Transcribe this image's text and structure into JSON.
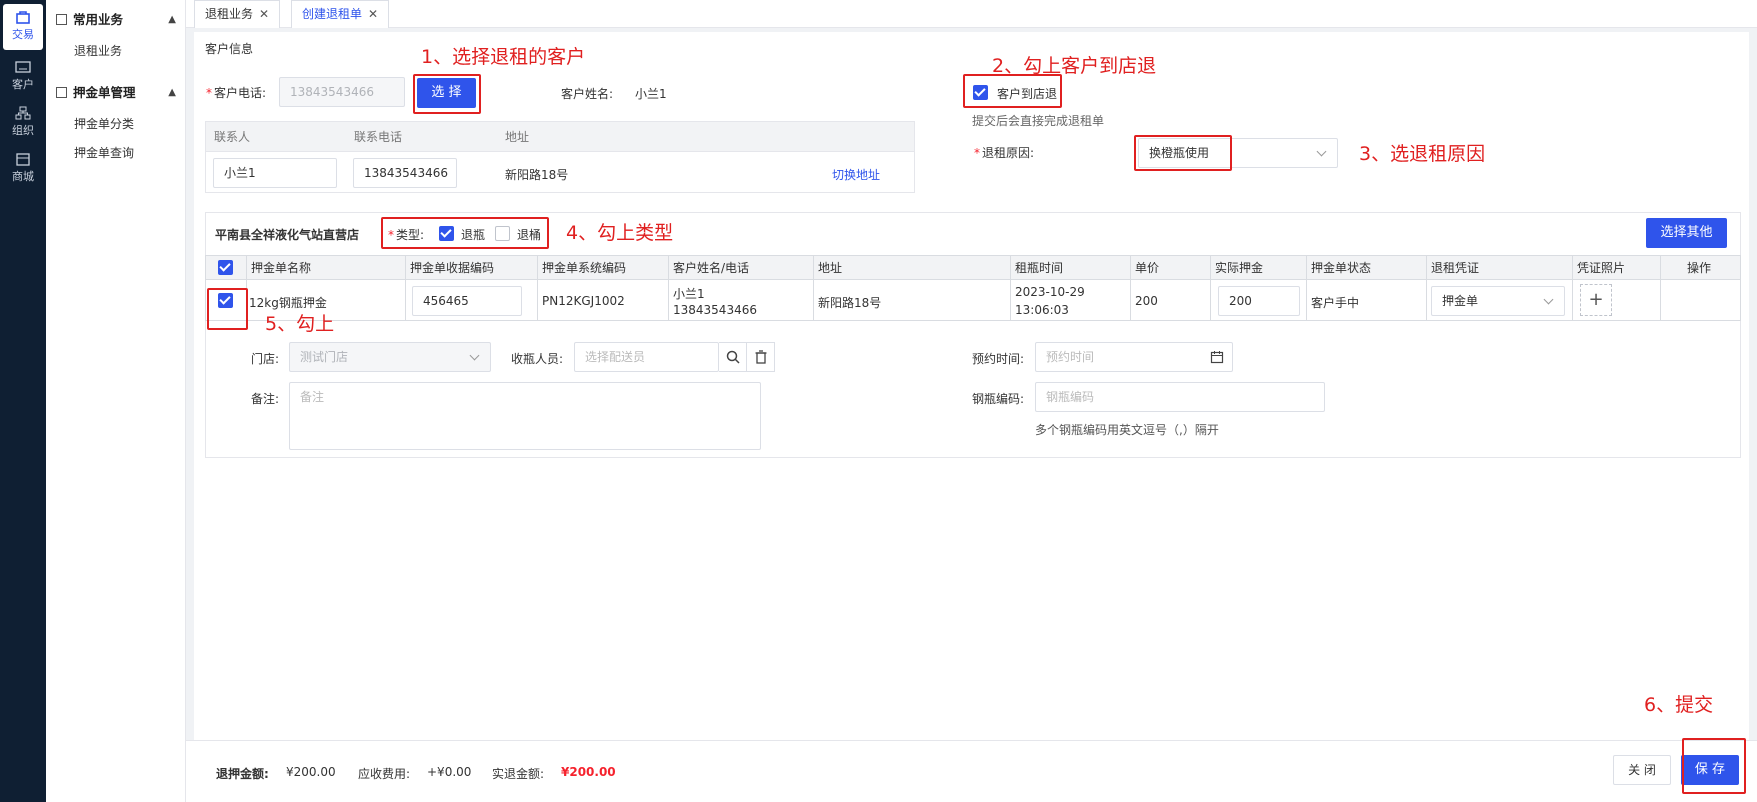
{
  "rail": [
    {
      "label": "交易",
      "icon": "bag-icon"
    },
    {
      "label": "客户",
      "icon": "id-card-icon"
    },
    {
      "label": "组织",
      "icon": "org-icon"
    },
    {
      "label": "商城",
      "icon": "store-icon"
    }
  ],
  "menu": {
    "groups": [
      {
        "label": "常用业务",
        "items": [
          "退租业务"
        ]
      },
      {
        "label": "押金单管理",
        "items": [
          "押金单分类",
          "押金单查询"
        ]
      }
    ]
  },
  "tabs": [
    {
      "label": "退租业务"
    },
    {
      "label": "创建退租单"
    }
  ],
  "customer": {
    "section_title": "客户信息",
    "phone_label": "客户电话:",
    "phone_value": "13843543466",
    "select_button": "选 择",
    "name_label": "客户姓名:",
    "name_value": "小兰1",
    "contact_table": {
      "headers": [
        "联系人",
        "联系电话",
        "地址"
      ],
      "row": {
        "contact": "小兰1",
        "phone": "13843543466",
        "address": "新阳路18号"
      },
      "switch_address": "切换地址"
    }
  },
  "store_return": {
    "checkbox_label": "客户到店退",
    "hint": "提交后会直接完成退租单",
    "reason_label": "退租原因:",
    "reason_value": "换橙瓶使用"
  },
  "store": {
    "name": "平南县全祥液化气站直营店",
    "type_label": "类型:",
    "type_options": [
      {
        "label": "退瓶",
        "checked": true
      },
      {
        "label": "退桶",
        "checked": false
      }
    ],
    "select_other_button": "选择其他"
  },
  "deposit_table": {
    "headers": [
      "押金单名称",
      "押金单收据编码",
      "押金单系统编码",
      "客户姓名/电话",
      "地址",
      "租瓶时间",
      "单价",
      "实际押金",
      "押金单状态",
      "退租凭证",
      "凭证照片",
      "操作"
    ],
    "row": {
      "name": "12kg钢瓶押金",
      "receipt_code": "456465",
      "system_code": "PN12KGJ1002",
      "customer_name": "小兰1",
      "customer_phone": "13843543466",
      "address": "新阳路18号",
      "rent_date": "2023-10-29",
      "rent_time": "13:06:03",
      "unit_price": "200",
      "actual_deposit": "200",
      "status": "客户手中",
      "voucher": "押金单",
      "photo_add": "+"
    }
  },
  "form": {
    "store_label": "门店:",
    "store_placeholder": "测试门店",
    "collector_label": "收瓶人员:",
    "collector_placeholder": "选择配送员",
    "appointment_label": "预约时间:",
    "appointment_placeholder": "预约时间",
    "remark_label": "备注:",
    "remark_placeholder": "备注",
    "cylinder_code_label": "钢瓶编码:",
    "cylinder_code_placeholder": "钢瓶编码",
    "cylinder_code_hint": "多个钢瓶编码用英文逗号（,）隔开"
  },
  "annotations": [
    "1、选择退租的客户",
    "2、勾上客户到店退",
    "3、选退租原因",
    "4、勾上类型",
    "5、勾上",
    "6、提交"
  ],
  "footer": {
    "refund_label": "退押金额:",
    "refund_value": "¥200.00",
    "fee_label": "应收费用:",
    "fee_value": "+¥0.00",
    "actual_label": "实退金额:",
    "actual_value": "¥200.00",
    "close_button": "关 闭",
    "save_button": "保 存"
  },
  "colors": {
    "primary": "#2f54eb",
    "annotation": "#e02020",
    "rail": "#0f1f33"
  }
}
